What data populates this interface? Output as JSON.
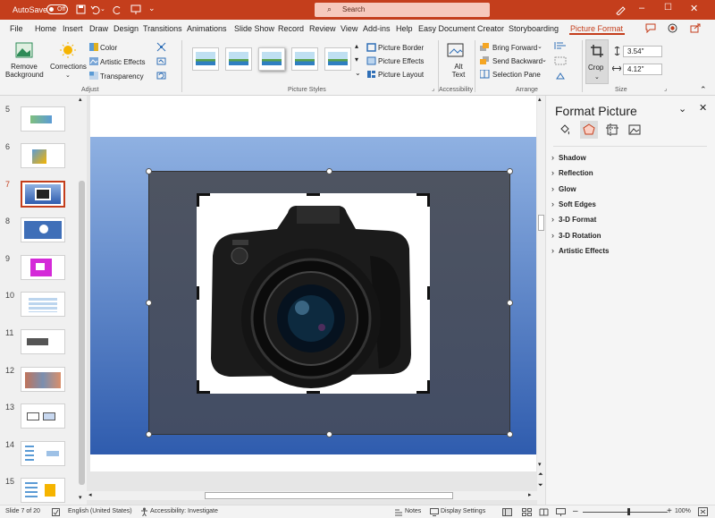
{
  "titlebar": {
    "autosave_label": "AutoSave",
    "autosave_state": "Off",
    "search_placeholder": "Search"
  },
  "menu": [
    "File",
    "Home",
    "Insert",
    "Draw",
    "Design",
    "Transitions",
    "Animations",
    "Slide Show",
    "Record",
    "Review",
    "View",
    "Add-ins",
    "Help",
    "Easy Document Creator",
    "Storyboarding",
    "Picture Format"
  ],
  "ribbon": {
    "remove_background": "Remove Background",
    "corrections": "Corrections",
    "color": "Color",
    "artistic_effects": "Artistic Effects",
    "transparency": "Transparency",
    "adjust_group": "Adjust",
    "picture_border": "Picture Border",
    "picture_effects": "Picture Effects",
    "picture_layout": "Picture Layout",
    "picture_styles_group": "Picture Styles",
    "alt_text": "Alt Text",
    "accessibility_group": "Accessibility",
    "bring_forward": "Bring Forward",
    "send_backward": "Send Backward",
    "selection_pane": "Selection Pane",
    "arrange_group": "Arrange",
    "crop": "Crop",
    "height_value": "3.54\"",
    "width_value": "4.12\"",
    "size_group": "Size"
  },
  "slides": {
    "numbers": [
      "5",
      "6",
      "7",
      "8",
      "9",
      "10",
      "11",
      "12",
      "13",
      "14",
      "15"
    ],
    "selected": "7"
  },
  "pane": {
    "title": "Format Picture",
    "sections": [
      "Shadow",
      "Reflection",
      "Glow",
      "Soft Edges",
      "3-D Format",
      "3-D Rotation",
      "Artistic Effects"
    ]
  },
  "status": {
    "slide_info": "Slide 7 of 20",
    "language": "English (United States)",
    "accessibility": "Accessibility: Investigate",
    "notes": "Notes",
    "display_settings": "Display Settings",
    "zoom": "100%"
  },
  "colors": {
    "accent": "#c43e1c",
    "slide_gradient_top": "#8fb1e2",
    "slide_gradient_bottom": "#2f5cae"
  }
}
